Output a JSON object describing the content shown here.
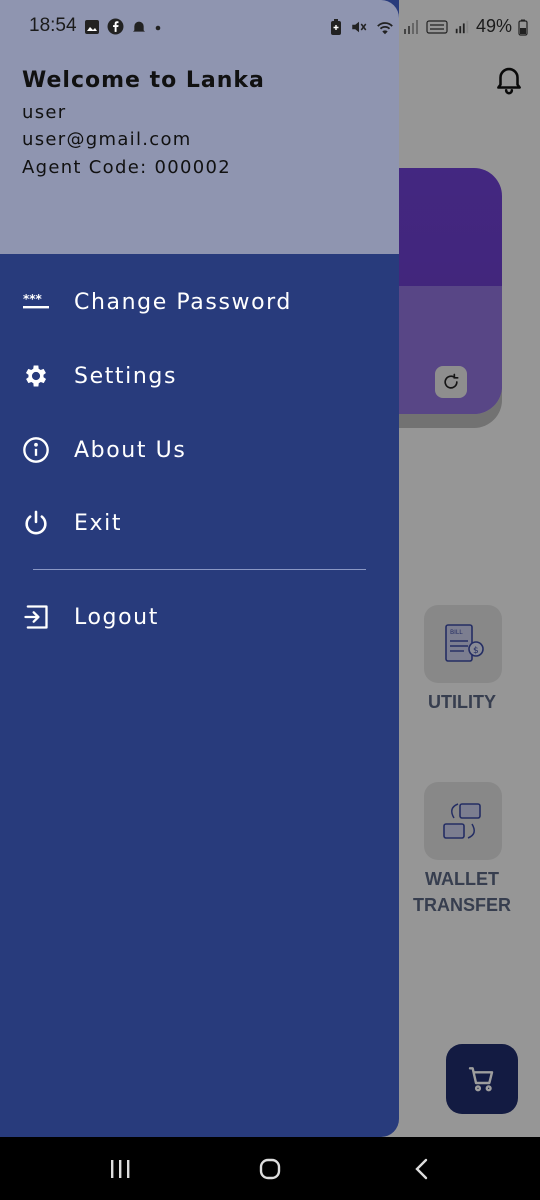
{
  "status_bar": {
    "time": "18:54",
    "battery": "49%"
  },
  "drawer": {
    "header": {
      "title": "Welcome to Lanka",
      "username": "user",
      "email": "user@gmail.com",
      "agent_code": "Agent Code: 000002"
    },
    "menu": [
      {
        "label": "Change Password",
        "icon": "password-icon"
      },
      {
        "label": "Settings",
        "icon": "gear-icon"
      },
      {
        "label": "About Us",
        "icon": "info-icon"
      },
      {
        "label": "Exit",
        "icon": "power-icon"
      },
      {
        "label": "Logout",
        "icon": "logout-icon"
      }
    ]
  },
  "background": {
    "services": [
      {
        "label": "UTILITY",
        "icon": "bill-icon"
      },
      {
        "label": "WALLET TRANSFER",
        "icon": "wallet-transfer-icon"
      }
    ]
  },
  "colors": {
    "drawer_bg": "#283b7c",
    "header_bg": "#8f95b0",
    "card_accent": "#6d3fd0",
    "cart_button": "#1f2c6b"
  }
}
